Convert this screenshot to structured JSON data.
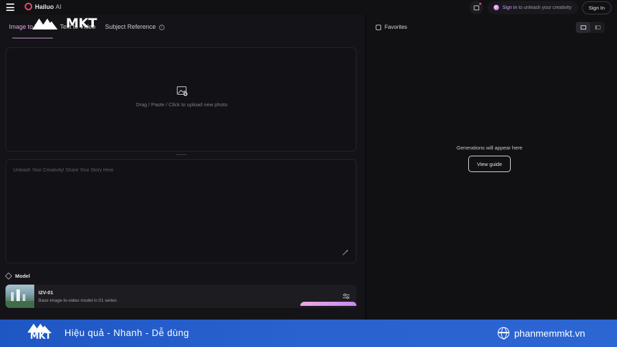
{
  "header": {
    "brand": "Hailuo",
    "brand_suffix": "AI",
    "signin_prompt_link": "Sign in",
    "signin_prompt_rest": "to unleash your creativity",
    "signin_button": "Sign In"
  },
  "tabs": [
    {
      "label": "Image to Video",
      "active": true
    },
    {
      "label": "Text to Video",
      "active": false
    },
    {
      "label": "Subject Reference",
      "active": false
    }
  ],
  "overlay_logo": "MKT",
  "upload": {
    "hint": "Drag / Paste / Click to upload new photo"
  },
  "prompt": {
    "placeholder": "Unleash Your Creativity! Share Your Story Here"
  },
  "model": {
    "section_label": "Model",
    "name": "I2V-01",
    "description": "Base image-to-video model in 01 series"
  },
  "gallery": {
    "favorites_label": "Favorites",
    "empty_text": "Generations will appear here",
    "view_guide_button": "View guide"
  },
  "banner": {
    "logo_text": "MKT",
    "slogan": "Hiệu quả - Nhanh - Dễ dùng",
    "website": "phanmemmkt.vn"
  },
  "colors": {
    "accent": "#e4a4e2",
    "background": "#111114",
    "banner": "#2a62cf"
  }
}
